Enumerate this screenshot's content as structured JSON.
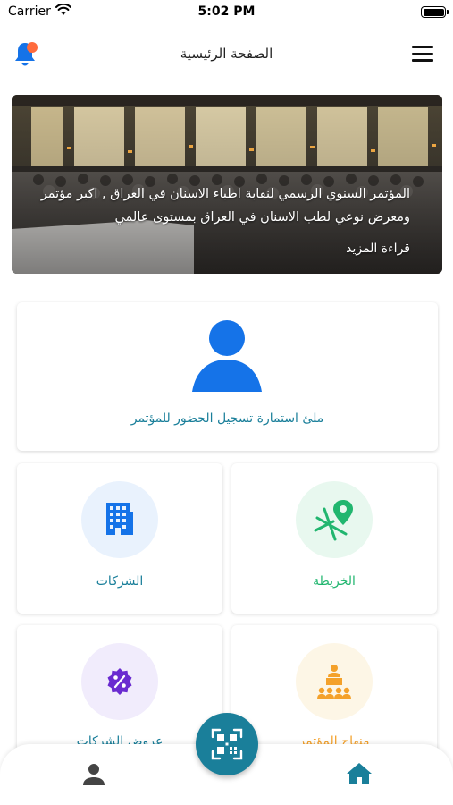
{
  "status_bar": {
    "carrier": "Carrier",
    "time": "5:02 PM"
  },
  "nav": {
    "title": "الصفحة الرئيسية",
    "bell_icon": "bell-icon",
    "menu_icon": "hamburger-menu-icon"
  },
  "banner": {
    "text": "المؤتمر السنوي الرسمي لنقابة اطباء الاسنان في العراق , اكبر مؤتمر ومعرض نوعي لطب الاسنان في العراق بمستوى عالمي",
    "read_more": "قراءة المزيد"
  },
  "cards": {
    "registration": {
      "label": "ملئ استمارة تسجيل الحضور للمؤتمر",
      "icon": "user-icon"
    },
    "companies": {
      "label": "الشركات",
      "icon": "building-icon"
    },
    "map": {
      "label": "الخريطة",
      "icon": "map-pin-icon"
    },
    "offers": {
      "label": "عروض الشركات",
      "icon": "percent-icon"
    },
    "agenda": {
      "label": "منهاج المؤتمر",
      "icon": "conference-icon"
    }
  },
  "fab": {
    "icon": "qr-code-icon"
  },
  "tabbar": {
    "left_icon": "person-icon",
    "right_icon": "home-icon"
  },
  "colors": {
    "primary_blue": "#1573e8",
    "teal": "#1a7f9a",
    "green": "#21b66f",
    "orange": "#f4a12a",
    "purple": "#6a2bd0",
    "bell_badge": "#ff6b3d"
  }
}
